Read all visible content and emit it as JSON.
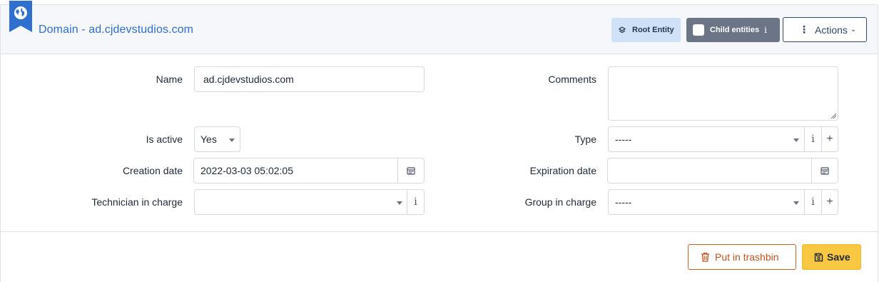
{
  "header": {
    "title": "Domain - ad.cjdevstudios.com",
    "root_entity_label": "Root Entity",
    "child_entities_label": "Child entities",
    "child_entities_info": "i",
    "actions_label": "Actions",
    "brand_color": "#2f6fcf"
  },
  "form": {
    "name": {
      "label": "Name",
      "value": "ad.cjdevstudios.com"
    },
    "comments": {
      "label": "Comments",
      "value": ""
    },
    "is_active": {
      "label": "Is active",
      "value": "Yes"
    },
    "type": {
      "label": "Type",
      "value": "-----"
    },
    "creation_date": {
      "label": "Creation date",
      "value": "2022-03-03 05:02:05"
    },
    "expiration_date": {
      "label": "Expiration date",
      "value": ""
    },
    "technician": {
      "label": "Technician in charge",
      "value": ""
    },
    "group": {
      "label": "Group in charge",
      "value": "-----"
    },
    "info_glyph": "i",
    "plus_glyph": "+"
  },
  "footer": {
    "trash_label": "Put in trashbin",
    "save_label": "Save",
    "trash_color": "#d35f1e",
    "save_color": "#f8c843"
  }
}
